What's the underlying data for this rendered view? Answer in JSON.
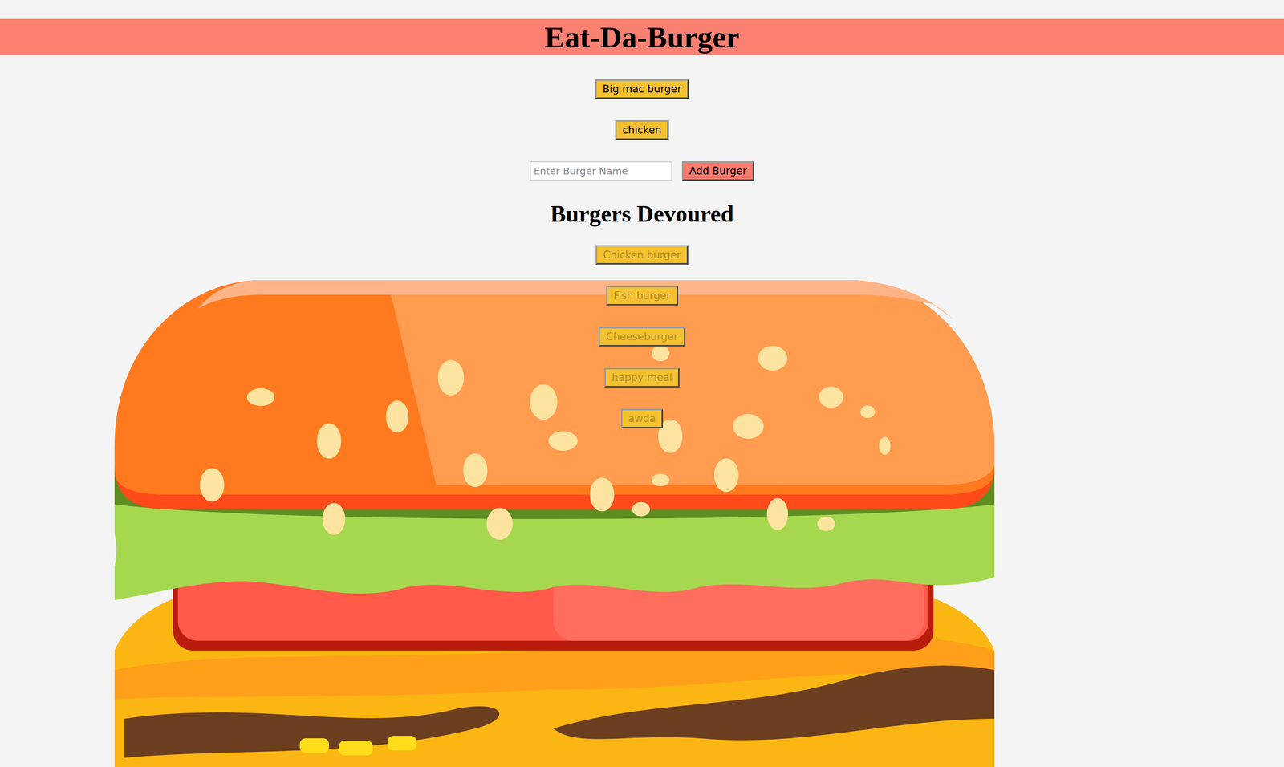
{
  "header": {
    "title": "Eat-Da-Burger"
  },
  "burgers": [
    {
      "name": "Big mac burger",
      "devoured": false
    },
    {
      "name": "chicken",
      "devoured": false
    }
  ],
  "form": {
    "placeholder": "Enter Burger Name",
    "button": "Add Burger"
  },
  "devoured_section": {
    "title": "Burgers Devoured"
  },
  "devoured": [
    {
      "name": "Chicken burger",
      "devoured": true
    },
    {
      "name": "Fish burger",
      "devoured": true
    },
    {
      "name": "Cheeseburger",
      "devoured": true
    },
    {
      "name": "happy meal",
      "devoured": true
    },
    {
      "name": "awda",
      "devoured": true
    }
  ]
}
